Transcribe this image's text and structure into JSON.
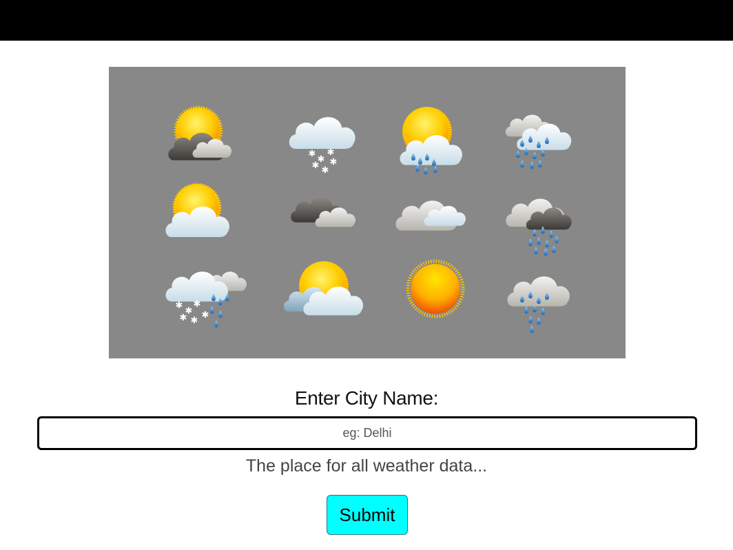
{
  "header": {
    "bg_color": "#000000"
  },
  "hero": {
    "bg_color": "#888888",
    "icons": [
      [
        "partly-cloudy-dark-icon",
        "snow-icon",
        "sun-rain-icon",
        "heavy-rain-icon"
      ],
      [
        "partly-cloudy-icon",
        "dark-clouds-icon",
        "overcast-icon",
        "thunder-rain-icon"
      ],
      [
        "sleet-icon",
        "sun-behind-clouds-icon",
        "sunny-icon",
        "rain-icon"
      ]
    ]
  },
  "form": {
    "label": "Enter City Name:",
    "input_placeholder": "eg: Delhi",
    "input_value": "",
    "tagline": "The place for all weather data...",
    "submit_label": "Submit",
    "submit_color": "#00ffff"
  }
}
